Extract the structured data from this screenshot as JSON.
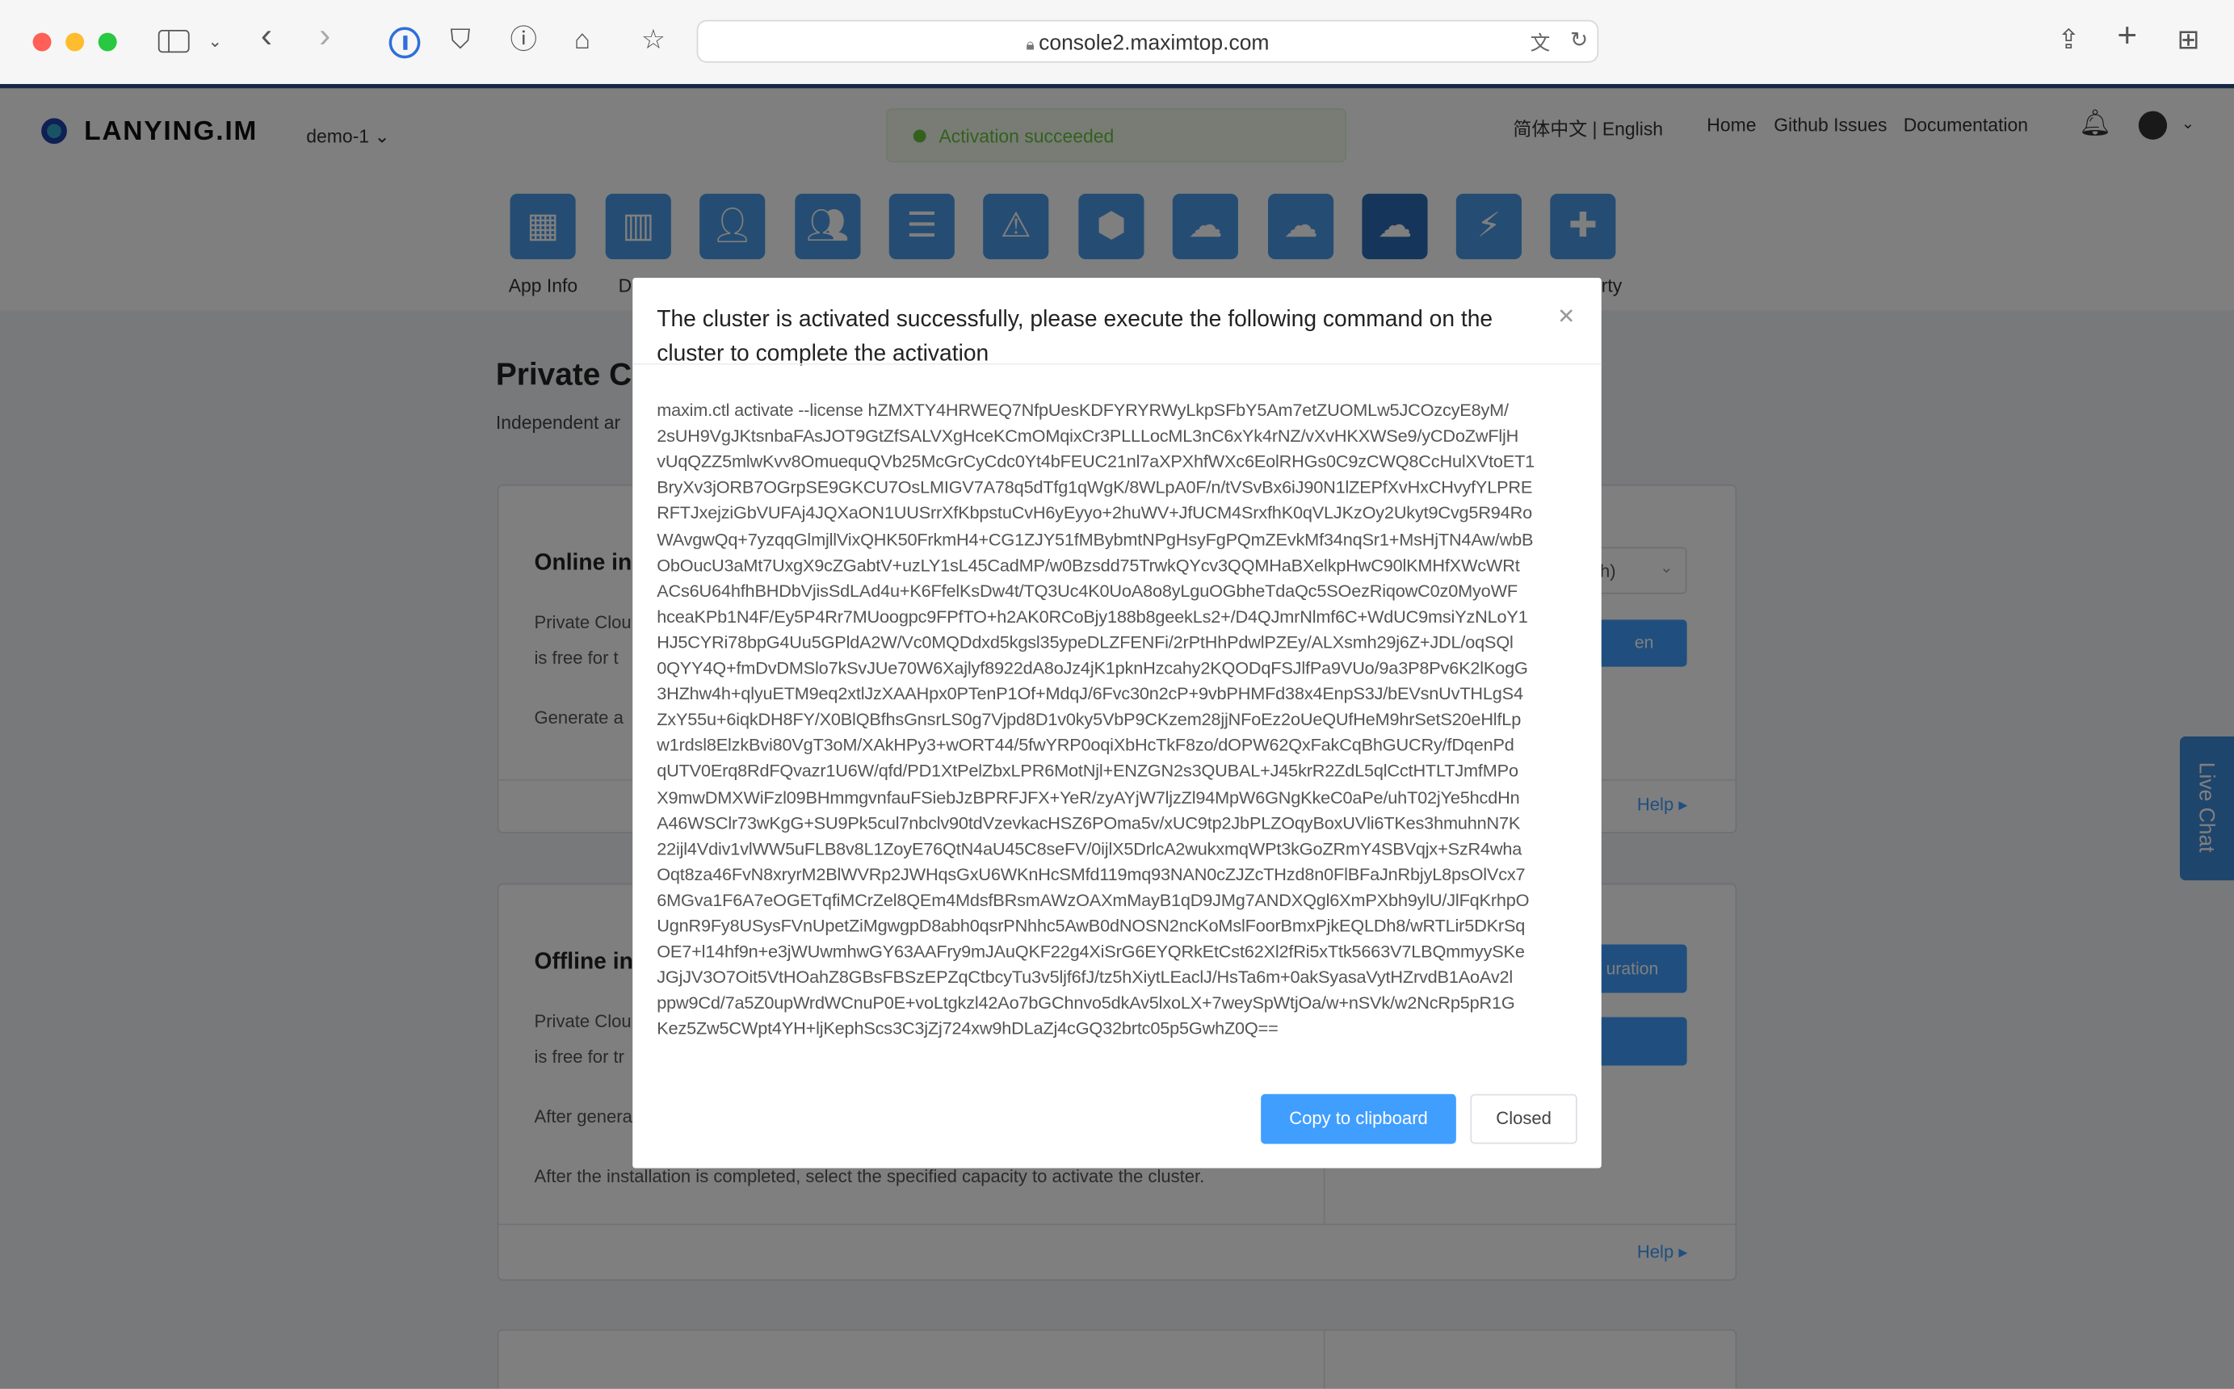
{
  "browser": {
    "url": "console2.maximtop.com",
    "icons": [
      "sidebar-icon",
      "chevron-down-icon",
      "back-icon",
      "forward-icon",
      "password-manager-icon",
      "shield-icon",
      "info-icon",
      "home-icon",
      "star-icon",
      "lock-icon",
      "translate-icon",
      "reload-icon",
      "share-icon",
      "new-tab-icon",
      "tab-overview-icon"
    ]
  },
  "header": {
    "logo": "LANYING.IM",
    "app_selector": "demo-1",
    "toast": "Activation succeeded",
    "language": "简体中文 | English",
    "links": [
      "Home",
      "Github Issues",
      "Documentation"
    ]
  },
  "iconbar": {
    "labels": [
      "App Info",
      "D",
      "rty"
    ],
    "accent": "#4a9ae6",
    "active": "#1f4f82"
  },
  "main": {
    "title": "Private C",
    "subtitle": "Independent ar",
    "online": {
      "title": "Online in",
      "lines": [
        "Private Clou",
        "is free for t",
        "Generate a"
      ],
      "select": "h)",
      "button": "en",
      "help": "Help"
    },
    "offline": {
      "title": "Offline in",
      "lines": [
        "Private Clou",
        "is free for tr",
        "After genera",
        "After the installation is completed, select the specified capacity to activate the cluster."
      ],
      "button": "uration",
      "help": "Help"
    }
  },
  "live_chat": "Live Chat",
  "modal": {
    "title": "The cluster is activated successfully, please execute the following command on the cluster to complete the activation",
    "command_lines": [
      "maxim.ctl activate --license hZMXTY4HRWEQ7NfpUesKDFYRYRWyLkpSFbY5Am7etZUOMLw5JCOzcyE8yM/",
      "2sUH9VgJKtsnbaFAsJOT9GtZfSALVXgHceKCmOMqixCr3PLLLocML3nC6xYk4rNZ/vXvHKXWSe9/yCDoZwFljH",
      "vUqQZZ5mlwKvv8OmuequQVb25McGrCyCdc0Yt4bFEUC21nl7aXPXhfWXc6EolRHGs0C9zCWQ8CcHulXVtoET1",
      "BryXv3jORB7OGrpSE9GKCU7OsLMIGV7A78q5dTfg1qWgK/8WLpA0F/n/tVSvBx6iJ90N1lZEPfXvHxCHvyfYLPRE",
      "RFTJxejziGbVUFAj4JQXaON1UUSrrXfKbpstuCvH6yEyyo+2huWV+JfUCM4SrxfhK0qVLJKzOy2Ukyt9Cvg5R94Ro",
      "WAvgwQq+7yzqqGlmjllVixQHK50FrkmH4+CG1ZJY51fMBybmtNPgHsyFgPQmZEvkMf34nqSr1+MsHjTN4Aw/wbB",
      "ObOucU3aMt7UxgX9cZGabtV+uzLY1sL45CadMP/w0Bzsdd75TrwkQYcv3QQMHaBXelkpHwC90lKMHfXWcWRt",
      "ACs6U64hfhBHDbVjisSdLAd4u+K6FfelKsDw4t/TQ3Uc4K0UoA8o8yLguOGbheTdaQc5SOezRiqowC0z0MyoWF",
      "hceaKPb1N4F/Ey5P4Rr7MUoogpc9FPfTO+h2AK0RCoBjy188b8geekLs2+/D4QJmrNlmf6C+WdUC9msiYzNLoY1",
      "HJ5CYRi78bpG4Uu5GPldA2W/Vc0MQDdxd5kgsl35ypeDLZFENFi/2rPtHhPdwlPZEy/ALXsmh29j6Z+JDL/oqSQl",
      "0QYY4Q+fmDvDMSlo7kSvJUe70W6Xajlyf8922dA8oJz4jK1pknHzcahy2KQODqFSJlfPa9VUo/9a3P8Pv6K2lKogG",
      "3HZhw4h+qlyuETM9eq2xtlJzXAAHpx0PTenP1Of+MdqJ/6Fvc30n2cP+9vbPHMFd38x4EnpS3J/bEVsnUvTHLgS4",
      "ZxY55u+6iqkDH8FY/X0BlQBfhsGnsrLS0g7Vjpd8D1v0ky5VbP9CKzem28jjNFoEz2oUeQUfHeM9hrSetS20eHlfLp",
      "w1rdsl8ElzkBvi80VgT3oM/XAkHPy3+wORT44/5fwYRP0oqiXbHcTkF8zo/dOPW62QxFakCqBhGUCRy/fDqenPd",
      "qUTV0Erq8RdFQvazr1U6W/qfd/PD1XtPelZbxLPR6MotNjl+ENZGN2s3QUBAL+J45krR2ZdL5qlCctHTLTJmfMPo",
      "X9mwDMXWiFzl09BHmmgvnfauFSiebJzBPRFJFX+YeR/zyAYjW7ljzZl94MpW6GNgKkeC0aPe/uhT02jYe5hcdHn",
      "A46WSClr73wKgG+SU9Pk5cul7nbclv90tdVzevkacHSZ6POma5v/xUC9tp2JbPLZOqyBoxUVli6TKes3hmuhnN7K",
      "22ijl4Vdiv1vlWW5uFLB8v8L1ZoyE76QtN4aU45C8seFV/0ijlX5DrlcA2wukxmqWPt3kGoZRmY4SBVqjx+SzR4wha",
      "Oqt8za46FvN8xryrM2BlWVRp2JWHqsGxU6WKnHcSMfd119mq93NAN0cZJZcTHzd8n0FlBFaJnRbjyL8psOlVcx7",
      "6MGva1F6A7eOGETqfiMCrZel8QEm4MdsfBRsmAWzOAXmMayB1qD9JMg7ANDXQgl6XmPXbh9ylU/JlFqKrhpO",
      "UgnR9Fy8USysFVnUpetZiMgwgpD8abh0qsrPNhhc5AwB0dNOSN2ncKoMslFoorBmxPjkEQLDh8/wRTLir5DKrSq",
      "OE7+l14hf9n+e3jWUwmhwGY63AAFry9mJAuQKF22g4XiSrG6EYQRkEtCst62Xl2fRi5xTtk5663V7LBQmmyySKe",
      "JGjJV3O7Oit5VtHOahZ8GBsFBSzEPZqCtbcyTu3v5ljf6fJ/tz5hXiytLEaclJ/HsTa6m+0akSyasaVytHZrvdB1AoAv2l",
      "ppw9Cd/7a5Z0upWrdWCnuP0E+voLtgkzl42Ao7bGChnvo5dkAv5lxoLX+7weySpWtjOa/w+nSVk/w2NcRp5pR1G",
      "Kez5Zw5CWpt4YH+ljKephScs3C3jZj724xw9hDLaZj4cGQ32brtc05p5GwhZ0Q=="
    ],
    "copy_button": "Copy to clipboard",
    "close_button": "Closed",
    "primary": "#409eff"
  }
}
